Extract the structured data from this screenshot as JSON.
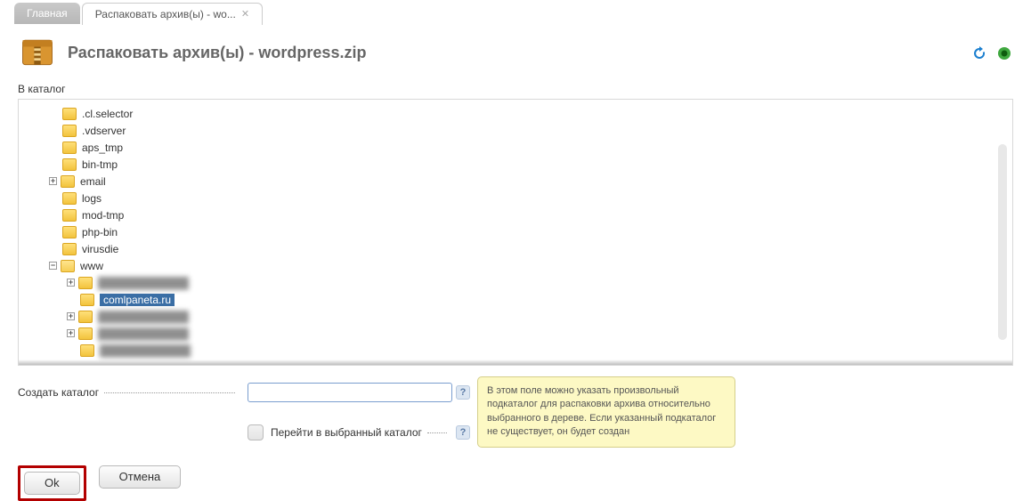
{
  "tabs": {
    "main": "Главная",
    "active": "Распаковать архив(ы) - wo..."
  },
  "header": {
    "title": "Распаковать архив(ы) - wordpress.zip"
  },
  "labels": {
    "to_catalog": "В каталог",
    "create_catalog": "Создать каталог",
    "go_to_selected": "Перейти в выбранный каталог"
  },
  "tree": {
    "items": [
      {
        "label": ".cl.selector",
        "depth": 0,
        "expand": null
      },
      {
        "label": ".vdserver",
        "depth": 0,
        "expand": null
      },
      {
        "label": "aps_tmp",
        "depth": 0,
        "expand": null
      },
      {
        "label": "bin-tmp",
        "depth": 0,
        "expand": null
      },
      {
        "label": "email",
        "depth": 0,
        "expand": "plus"
      },
      {
        "label": "logs",
        "depth": 0,
        "expand": null
      },
      {
        "label": "mod-tmp",
        "depth": 0,
        "expand": null
      },
      {
        "label": "php-bin",
        "depth": 0,
        "expand": null
      },
      {
        "label": "virusdie",
        "depth": 0,
        "expand": null
      },
      {
        "label": "www",
        "depth": 0,
        "expand": "minus",
        "open": true
      },
      {
        "label": "",
        "depth": 1,
        "expand": "plus",
        "blur": true
      },
      {
        "label": "comlpaneta.ru",
        "depth": 1,
        "expand": null,
        "selected": true
      },
      {
        "label": "",
        "depth": 1,
        "expand": "plus",
        "blur": true
      },
      {
        "label": "",
        "depth": 1,
        "expand": "plus",
        "blur": true
      },
      {
        "label": "",
        "depth": 1,
        "expand": null,
        "blur": true
      }
    ]
  },
  "tooltip": "В этом поле можно указать произвольный подкаталог для распаковки архива относительно выбранного в дереве. Если указанный подкаталог не существует, он будет создан",
  "input": {
    "create_catalog_value": ""
  },
  "buttons": {
    "ok": "Ok",
    "cancel": "Отмена"
  }
}
